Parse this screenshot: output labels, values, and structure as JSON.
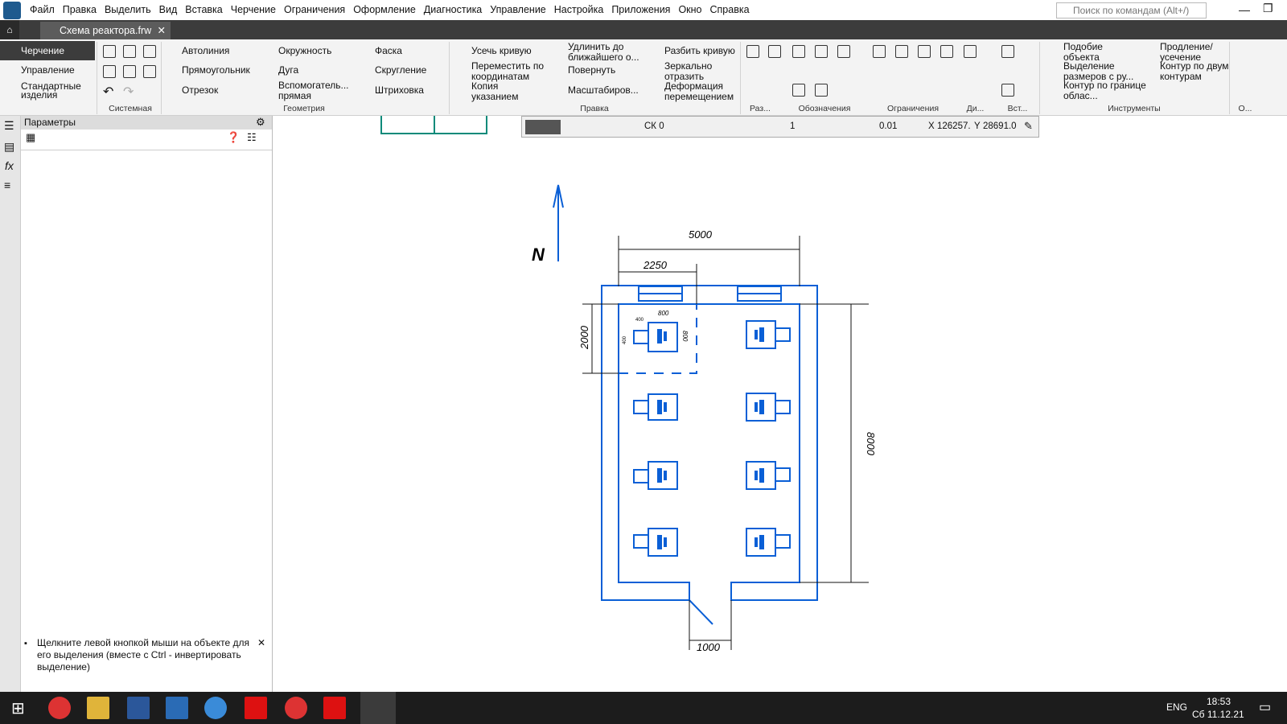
{
  "menu": [
    "Файл",
    "Правка",
    "Выделить",
    "Вид",
    "Вставка",
    "Черчение",
    "Ограничения",
    "Оформление",
    "Диагностика",
    "Управление",
    "Настройка",
    "Приложения",
    "Окно",
    "Справка"
  ],
  "search_placeholder": "Поиск по командам (Alt+/)",
  "doc_tab": "Схема реактора.frw",
  "sidetabs": [
    "Черчение",
    "Управление",
    "Стандартные изделия"
  ],
  "groups": [
    "Системная",
    "Геометрия",
    "Правка",
    "Раз...",
    "Обозначения",
    "Ограничения",
    "Ди...",
    "Вст...",
    "Инструменты",
    "О..."
  ],
  "geometry": [
    "Автолиния",
    "Окружность",
    "Фаска",
    "Прямоугольник",
    "Дуга",
    "Скругление",
    "Отрезок",
    "Вспомогатель... прямая",
    "Штриховка"
  ],
  "edit": [
    "Усечь кривую",
    "Удлинить до ближайшего о...",
    "Разбить кривую",
    "Переместить по координатам",
    "Повернуть",
    "Зеркально отразить",
    "Копия указанием",
    "Масштабиров...",
    "Деформация перемещением"
  ],
  "tools": [
    "Подобие объекта",
    "Продление/ усечение",
    "Выделение размеров с ру...",
    "Контур по двум контурам",
    "Контур по границе облас..."
  ],
  "panel_title": "Параметры",
  "hint": "Щелкните левой кнопкой мыши на объекте для его выделения (вместе с Ctrl - инвертировать выделение)",
  "ctrl": {
    "cs": "СК 0",
    "step": "1",
    "zoom": "0.01",
    "x_label": "X",
    "x": "126257.",
    "y_label": "Y",
    "y": "28691.0"
  },
  "drawing": {
    "north": "N",
    "dim_width": "5000",
    "dim_part": "2250",
    "dim_height": "2000",
    "dim_length": "8000",
    "dim_door": "1000",
    "dim_small_w": "800",
    "dim_small_h": "800",
    "dim_small_a": "400",
    "dim_small_b": "400"
  },
  "clock": {
    "time": "18:53",
    "date": "Сб 11.12.21"
  },
  "lang": "ENG",
  "colors": {
    "accent": "#0a5fd6",
    "dark": "#3c3c3c",
    "teal": "#0a8a7a"
  }
}
